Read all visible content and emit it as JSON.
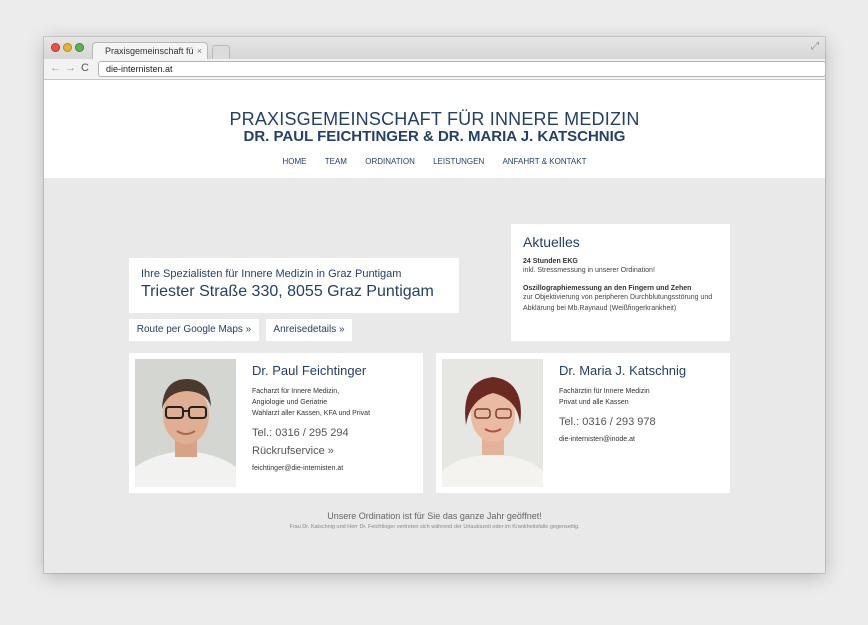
{
  "browser": {
    "tab_title": "Praxisgemeinschaft für",
    "tab_close": "×",
    "url": "die-internisten.at",
    "back_glyph": "←",
    "forward_glyph": "→",
    "reload_glyph": "C",
    "fullscreen_glyph": "⤢"
  },
  "header": {
    "title": "PRAXISGEMEINSCHAFT FÜR INNERE MEDIZIN",
    "subtitle": "DR. PAUL FEICHTINGER & DR. MARIA J. KATSCHNIG"
  },
  "nav": {
    "items": [
      {
        "label": "HOME"
      },
      {
        "label": "TEAM"
      },
      {
        "label": "ORDINATION"
      },
      {
        "label": "LEISTUNGEN"
      },
      {
        "label": "ANFAHRT & KONTAKT"
      }
    ]
  },
  "aktuelles": {
    "title": "Aktuelles",
    "items": [
      {
        "title": "24 Stunden EKG",
        "text": "inkl. Stressmessung in unserer Ordination!"
      },
      {
        "title": "Oszillographiemessung an den Fingern und Zehen",
        "text": "zur Objektivierung von peripheren Durchblutungsstörung und Abklärung bei Mb.Raynaud (Weißfingerkrankheit)"
      }
    ]
  },
  "intro": {
    "line1": "Ihre Spezialisten für Innere Medizin in Graz Puntigam",
    "address": "Triester Straße 330, 8055 Graz Puntigam"
  },
  "buttons": {
    "route": "Route per Google Maps »",
    "anreise": "Anreisedetails »"
  },
  "doctors": [
    {
      "name": "Dr. Paul Feichtinger",
      "desc1": "Facharzt für Innere Medizin,",
      "desc2": "Angiologie und Geriatrie",
      "desc3": "Wahlarzt aller Kassen, KFA und Privat",
      "tel": "Tel.: 0316 / 295 294",
      "rueckruf": "Rückrufservice »",
      "email": "feichtinger@die-internisten.at"
    },
    {
      "name": "Dr. Maria J. Katschnig",
      "desc1": "Fachärztin für Innere Medizin",
      "desc2": "Privat und alle Kassen",
      "tel": "Tel.: 0316 / 293 978",
      "email": "die-internisten@inode.at"
    }
  ],
  "footer": {
    "main": "Unsere Ordination ist für Sie das ganze Jahr geöffnet!",
    "sub": "Frau Dr. Katschnig und Herr Dr. Feichtinger vertreten sich während der Urlaubszeit oder im Krankheitsfalle gegenseitig."
  }
}
